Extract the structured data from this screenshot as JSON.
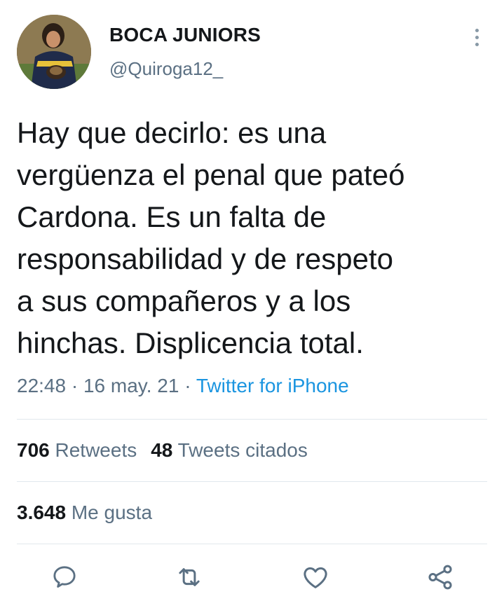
{
  "author": {
    "display_name": "BOCA JUNIORS",
    "handle": "@Quiroga12_",
    "avatar_icon": "profile-photo"
  },
  "tweet": {
    "text": "Hay que decirlo: es una\nvergüenza el penal que pateó\nCardona. Es un falta de\nresponsabilidad y de respeto\na sus compañeros y a los\nhinchas. Displicencia total.",
    "time": "22:48",
    "separator1": " · ",
    "date": "16 may. 21",
    "separator2": " · ",
    "source": "Twitter for iPhone"
  },
  "stats": {
    "retweets_count": "706",
    "retweets_label": "Retweets",
    "quotes_count": "48",
    "quotes_label": "Tweets citados",
    "likes_count": "3.648",
    "likes_label": "Me gusta"
  },
  "actions": {
    "reply_icon": "reply-icon",
    "retweet_icon": "retweet-icon",
    "like_icon": "heart-icon",
    "share_icon": "share-icon"
  },
  "colors": {
    "text": "#14171a",
    "secondary": "#5b7083",
    "link": "#1b95e0",
    "divider": "#e1e8ed"
  }
}
